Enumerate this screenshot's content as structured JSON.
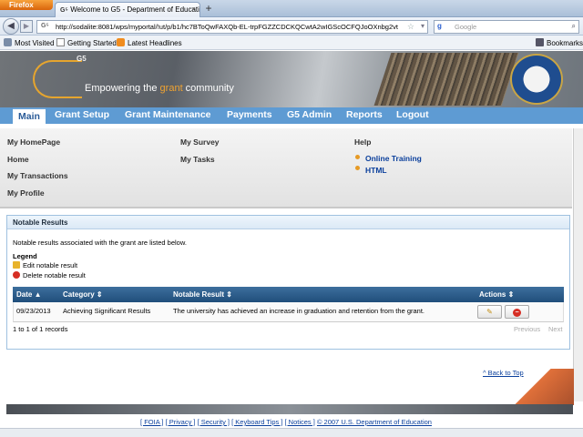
{
  "browser": {
    "menu_button": "Firefox",
    "tab_title": "Welcome to G5 - Department of Educatio...",
    "tab_favicon": "G5",
    "new_tab": "+",
    "url": "http://sodalite:8081/wps/myportal/!ut/p/b1/hc7BToQwFAXQb-EL-trpFGZZCDCKQCwtA2wIGScOCFQJoOXnbg2vt",
    "search_placeholder": "Google",
    "bookmarks": [
      "Most Visited",
      "Getting Started",
      "Latest Headlines"
    ],
    "bookmarks_menu": "Bookmarks"
  },
  "header": {
    "logo": "G5",
    "tagline_pre": "Empowering the ",
    "tagline_accent": "grant",
    "tagline_post": " community",
    "seal_icon": "department-of-education-seal"
  },
  "nav": {
    "items": [
      "Main",
      "Grant Setup",
      "Grant Maintenance",
      "Payments",
      "G5 Admin",
      "Reports",
      "Logout"
    ],
    "active": "Main",
    "color": "#5e9bd3"
  },
  "submenu": {
    "col1": [
      "My HomePage",
      "Home",
      "My Transactions",
      "My Profile"
    ],
    "col2": [
      "My Survey",
      "My Tasks"
    ],
    "help_title": "Help",
    "help_links": [
      "Online Training",
      "HTML"
    ]
  },
  "panel": {
    "title": "Notable Results",
    "description": "Notable results associated with the grant are listed below.",
    "legend_title": "Legend",
    "legend_edit": "Edit notable result",
    "legend_delete": "Delete notable result",
    "columns": [
      "Date",
      "Category",
      "Notable Result",
      "Actions"
    ],
    "sort_indicators": [
      "▲",
      "⇕",
      "⇕",
      "⇕"
    ],
    "rows": [
      {
        "date": "09/23/2013",
        "category": "Achieving Significant Results",
        "result": "The university has achieved an increase in graduation and retention from the grant."
      }
    ],
    "record_count": "1 to 1 of 1 records",
    "previous": "Previous",
    "next": "Next"
  },
  "footer": {
    "back_to_top": "^ Back to Top",
    "links": [
      "[ FOIA ]",
      "[ Privacy ]",
      "[ Security ]",
      "[ Keyboard Tips ]",
      "[ Notices ]",
      "© 2007 U.S. Department of Education"
    ]
  }
}
